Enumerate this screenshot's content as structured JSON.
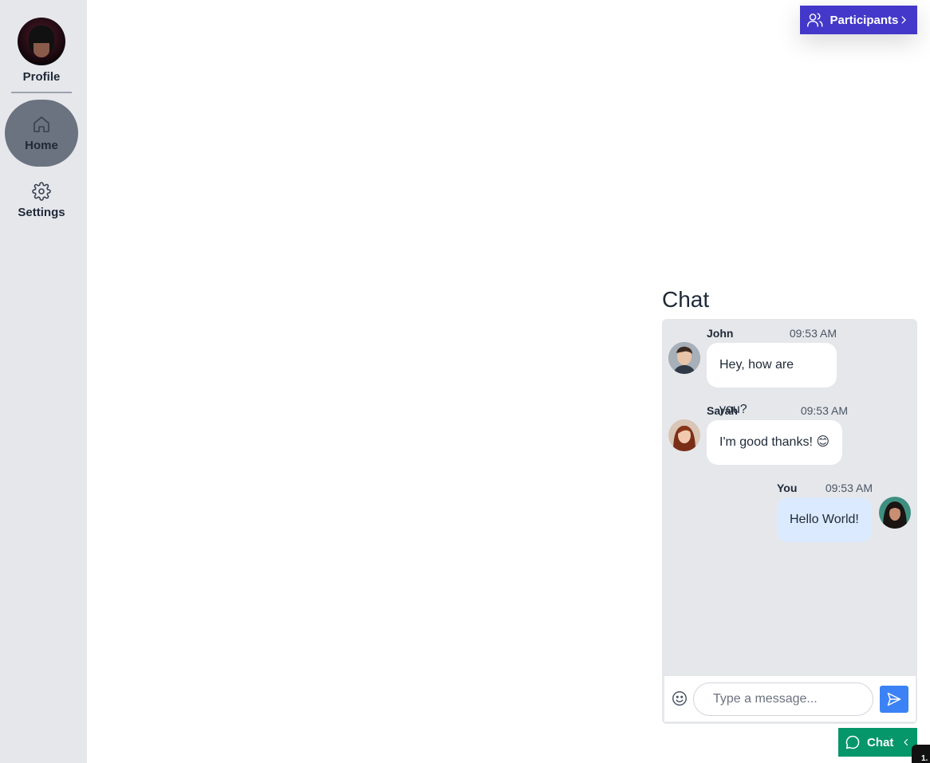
{
  "sidebar": {
    "profile_label": "Profile",
    "items": [
      {
        "label": "Home",
        "icon": "home-icon",
        "active": true
      },
      {
        "label": "Settings",
        "icon": "gear-icon",
        "active": false
      }
    ]
  },
  "participants_button": {
    "label": "Participants",
    "icon": "users-icon"
  },
  "chat": {
    "title": "Chat",
    "messages": [
      {
        "name": "John",
        "time": "09:53 AM",
        "text": "Hey, how are you?"
      },
      {
        "name": "Sarah",
        "time": "09:53 AM",
        "text": "I'm good thanks! 😊"
      },
      {
        "name": "You",
        "time": "09:53 AM",
        "text": "Hello World!"
      }
    ],
    "input_placeholder": "Type a message...",
    "input_value": ""
  },
  "chat_toggle": {
    "label": "Chat"
  },
  "corner_tag": "1.",
  "colors": {
    "sidebar_bg": "#e5e7eb",
    "active_nav": "#6b7280",
    "participants_bg": "#4338ca",
    "chat_toggle_bg": "#059669",
    "send_bg": "#3b82f6",
    "my_bubble": "#dbeafe"
  }
}
